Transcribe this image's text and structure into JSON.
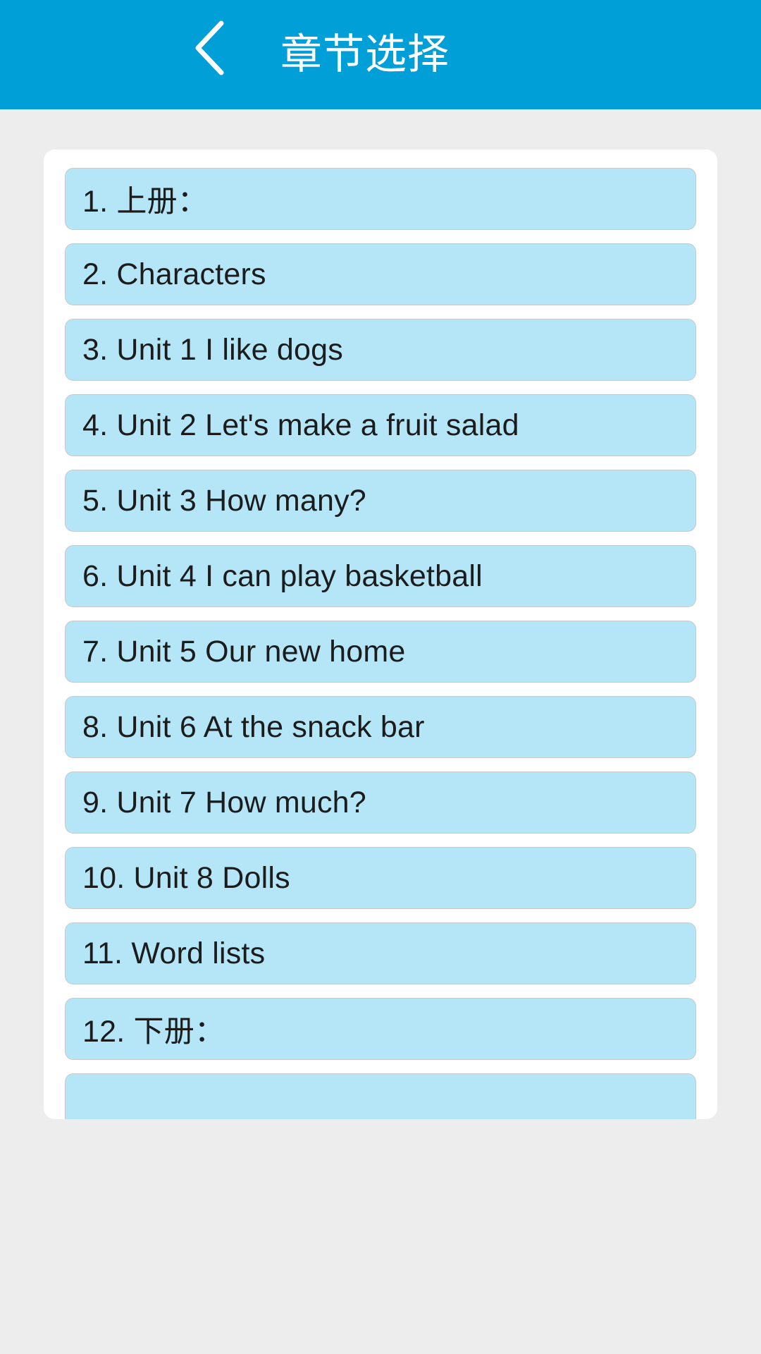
{
  "header": {
    "title": "章节选择",
    "back_icon": "chevron-left-icon",
    "background_color": "#009fd7",
    "text_color": "#ffffff"
  },
  "theme": {
    "page_background": "#ededed",
    "card_background": "#ffffff",
    "item_background": "#b4e6f8",
    "item_border": "#c9c9c9",
    "item_text_color": "#1c1c1c"
  },
  "chapters": [
    {
      "label": "1. 上册："
    },
    {
      "label": "2. Characters"
    },
    {
      "label": "3. Unit 1 I like dogs"
    },
    {
      "label": "4. Unit 2 Let's make a fruit salad"
    },
    {
      "label": "5. Unit 3 How many?"
    },
    {
      "label": "6. Unit 4 I can play basketball"
    },
    {
      "label": "7. Unit 5 Our new home"
    },
    {
      "label": "8. Unit 6 At the snack bar"
    },
    {
      "label": "9. Unit 7 How much?"
    },
    {
      "label": "10. Unit 8 Dolls"
    },
    {
      "label": "11. Word lists"
    },
    {
      "label": "12. 下册："
    },
    {
      "label": ""
    }
  ]
}
